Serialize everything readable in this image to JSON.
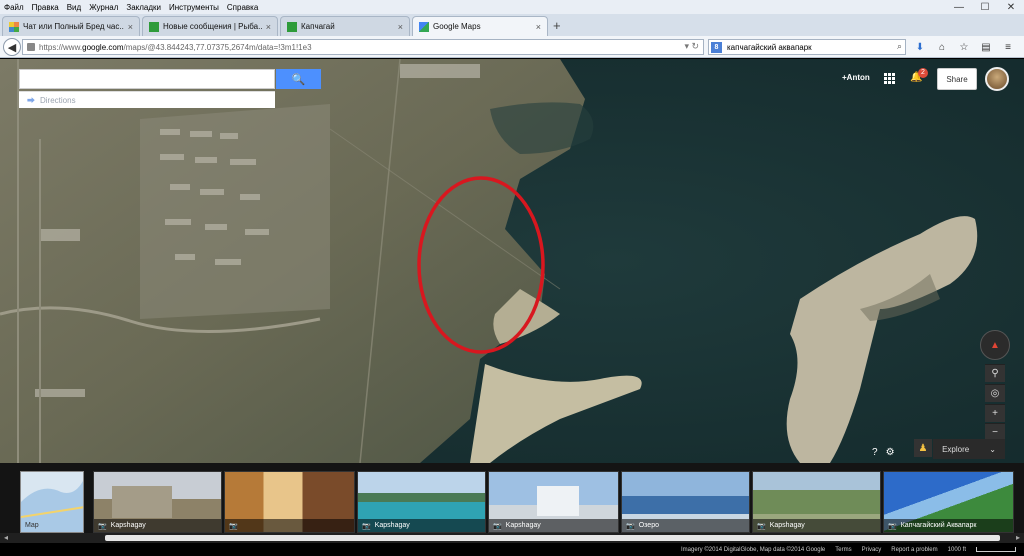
{
  "menu": [
    "Файл",
    "Правка",
    "Вид",
    "Журнал",
    "Закладки",
    "Инструменты",
    "Справка"
  ],
  "window_controls": {
    "minimize": "—",
    "maximize": "☐",
    "close": "✕"
  },
  "tabs": [
    {
      "label": "Чат или Полный Бред час...",
      "close": "×",
      "favicon_color": "#3c8dd8"
    },
    {
      "label": "Новые сообщения | Рыба...",
      "close": "×",
      "favicon_color": "#2e9b3a"
    },
    {
      "label": "Капчагай",
      "close": "×",
      "favicon_color": "#2e9b3a"
    },
    {
      "label": "Google Maps",
      "close": "×",
      "favicon_color": "#4285f4"
    }
  ],
  "new_tab": "+",
  "nav": {
    "url_prefix": "https://www.",
    "url_host": "google.com",
    "url_rest": "/maps/@43.844243,77.07375,2674m/data=!3m1!1e3",
    "search_value": "капчагайский аквапарк",
    "search_engine": "8",
    "url_icons": "▾ ↻"
  },
  "map": {
    "search_placeholder": "",
    "search_button": "🔍",
    "directions_label": "Directions",
    "account_name": "+Anton",
    "notification_count": "2",
    "share_label": "Share",
    "explore_label": "Explore",
    "explore_chevron": "⌄",
    "compass_glyph": "▲",
    "zoom_in": "+",
    "zoom_out": "−"
  },
  "thumbnails": {
    "map_label": "Map",
    "items": [
      {
        "caption": "Kapshagay"
      },
      {
        "caption": ""
      },
      {
        "caption": "Kapshagay"
      },
      {
        "caption": "Kapshagay"
      },
      {
        "caption": "Озеро"
      },
      {
        "caption": "Kapshagay"
      },
      {
        "caption": "Капчагайский Аквапарк"
      }
    ]
  },
  "footer": {
    "imagery": "Imagery ©2014 DigitalGlobe, Map data ©2014 Google",
    "terms": "Terms",
    "privacy": "Privacy",
    "report": "Report a problem",
    "scale": "1000 ft"
  }
}
